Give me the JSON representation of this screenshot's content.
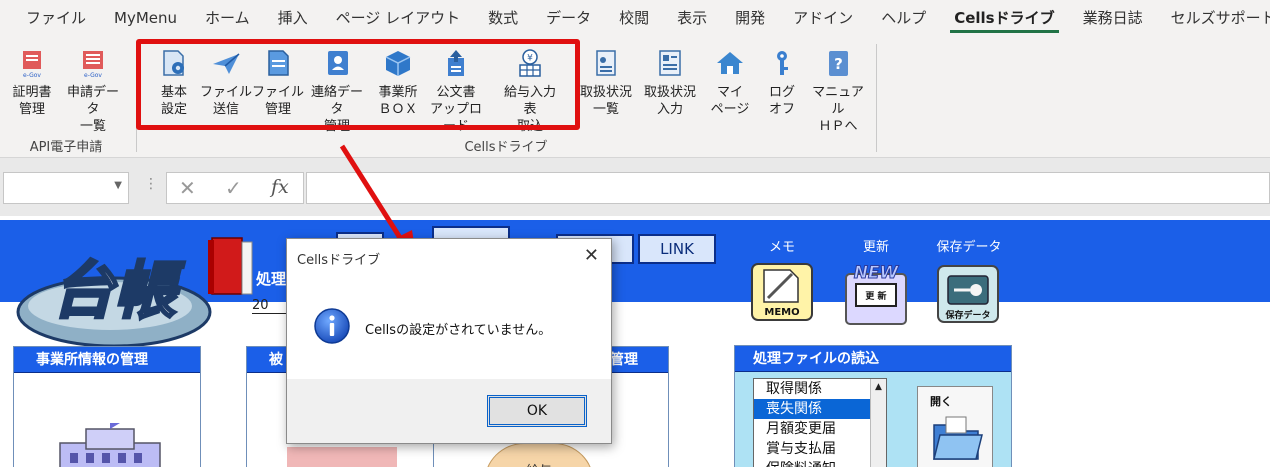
{
  "tabs": [
    "ファイル",
    "MyMenu",
    "ホーム",
    "挿入",
    "ページ レイアウト",
    "数式",
    "データ",
    "校閲",
    "表示",
    "開発",
    "アドイン",
    "ヘルプ",
    "Cellsドライブ",
    "業務日誌",
    "セルズサポート"
  ],
  "active_tab": "Cellsドライブ",
  "ribbon": {
    "api_group": {
      "label": "API電子申請",
      "buttons": [
        {
          "label": "証明書\n管理",
          "icon": "egov-certificate-icon"
        },
        {
          "label": "申請データ\n一覧",
          "icon": "egov-list-icon"
        }
      ]
    },
    "cells_group": {
      "label": "Cellsドライブ",
      "buttons": [
        {
          "label": "基本\n設定",
          "icon": "settings-doc-icon"
        },
        {
          "label": "ファイル\n送信",
          "icon": "paper-plane-icon"
        },
        {
          "label": "ファイル\n管理",
          "icon": "file-manage-icon"
        },
        {
          "label": "連絡データ\n管理",
          "icon": "contact-book-icon"
        },
        {
          "label": "事業所\nＢＯＸ",
          "icon": "box-icon"
        },
        {
          "label": "公文書\nアップロード",
          "icon": "upload-doc-icon"
        },
        {
          "label": "給与入力表\n取込",
          "icon": "yen-grid-icon"
        },
        {
          "label": "取扱状況\n一覧",
          "icon": "status-list-icon"
        },
        {
          "label": "取扱状況\n入力",
          "icon": "status-input-icon"
        },
        {
          "label": "マイ\nページ",
          "icon": "home-icon"
        },
        {
          "label": "ログ\nオフ",
          "icon": "key-icon"
        },
        {
          "label": "マニュアル\nＨＰへ",
          "icon": "manual-icon"
        }
      ]
    }
  },
  "formula_bar": {
    "fx": "fx",
    "cancel": "✕",
    "enter": "✓"
  },
  "sheet": {
    "logo_text": "台帳",
    "shori_label": "処理",
    "nen_value": "20",
    "link_button": "LINK",
    "memo": {
      "caption": "メモ",
      "label": "MEMO"
    },
    "update": {
      "caption": "更新",
      "badge": "NEW",
      "label": "更 新"
    },
    "save": {
      "caption": "保存データ",
      "label": "保存データ"
    },
    "panels": [
      {
        "title": "事業所情報の管理"
      },
      {
        "title": "被"
      },
      {
        "title": "管理"
      }
    ],
    "kyuyo_fragment": "給与",
    "file_panel": {
      "title": "処理ファイルの読込",
      "items": [
        "取得関係",
        "喪失関係",
        "月額変更届",
        "賞与支払届",
        "保険料通知"
      ],
      "selected_index": 1,
      "open_label": "開く"
    }
  },
  "dialog": {
    "title": "Cellsドライブ",
    "message": "Cellsの設定がされていません。",
    "ok": "OK"
  },
  "colors": {
    "highlight": "#e01010",
    "sheet_blue": "#1b5fe8",
    "excel_green": "#217346"
  }
}
